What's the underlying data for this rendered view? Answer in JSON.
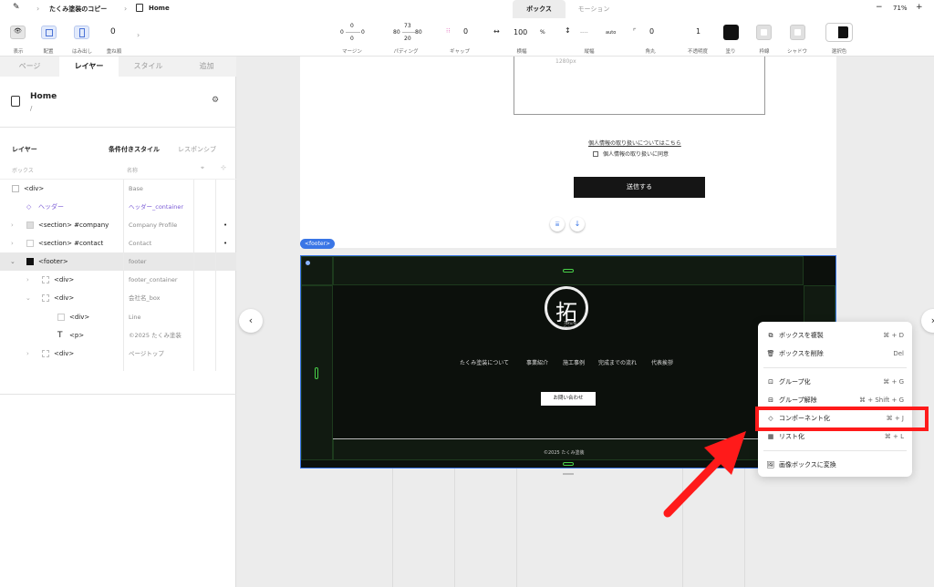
{
  "topbar": {
    "breadcrumb_project": "たくみ塗装のコピー",
    "breadcrumb_page": "Home",
    "tabs": [
      "ボックス",
      "モーション"
    ],
    "zoom": "71%",
    "minus": "−",
    "plus": "+"
  },
  "toolbar": {
    "display": "表示",
    "placement": "配置",
    "overflow": "はみ出し",
    "stack_value": "0",
    "stack_label": "重ね順",
    "margin": {
      "top": "0",
      "left": "0",
      "right": "0",
      "bottom": "0",
      "label": "マージン"
    },
    "padding": {
      "top": "73",
      "left": "80",
      "right": "80",
      "bottom": "20",
      "label": "パディング"
    },
    "gap": {
      "value": "0",
      "label": "ギャップ"
    },
    "width": {
      "value": "100",
      "unit": "%",
      "label": "横幅"
    },
    "height": {
      "value": "----",
      "unit": "auto",
      "label": "縦幅"
    },
    "radius": {
      "value": "0",
      "label": "角丸"
    },
    "opacity": {
      "value": "1",
      "label": "不透明度"
    },
    "fill": "塗り",
    "border": "枠線",
    "shadow": "シャドウ",
    "selection_color": "選択色",
    "colors": {
      "fill": "#111111",
      "accent": "#3a76e6",
      "highlight": "#ff1a1a"
    }
  },
  "panel": {
    "tabs": [
      "ページ",
      "レイヤー",
      "スタイル",
      "追加"
    ],
    "page_title": "Home",
    "page_path": "/",
    "layer_heading": "レイヤー",
    "conditional_style": "条件付きスタイル",
    "responsive": "レスポンシブ",
    "col_box": "ボックス",
    "col_name": "名称",
    "layers": [
      {
        "label": "<div>",
        "name": "Base"
      },
      {
        "label": "ヘッダー",
        "name": "ヘッダー_container"
      },
      {
        "label": "<section> #company",
        "name": "Company Profile",
        "dot": "•"
      },
      {
        "label": "<section> #contact",
        "name": "Contact",
        "dot": "•"
      },
      {
        "label": "<footer>",
        "name": "footer"
      },
      {
        "label": "<div>",
        "name": "footer_container"
      },
      {
        "label": "<div>",
        "name": "会社名_box"
      },
      {
        "label": "<div>",
        "name": "Line"
      },
      {
        "label": "<p>",
        "name": "©2025 たくみ塗装"
      },
      {
        "label": "<div>",
        "name": "ページトップ"
      }
    ]
  },
  "canvas": {
    "width_hint": "1280px",
    "privacy_link": "個人情報の取り扱いについてはこちら",
    "privacy_checkbox": "個人情報の取り扱いに同意",
    "submit": "送信する",
    "footer_tag": "<footer>",
    "logo_char": "拓",
    "logo_sub": "Takumi Paint",
    "nav": [
      "たくみ塗装について",
      "事業紹介",
      "施工事例",
      "完成までの流れ",
      "代表挨拶"
    ],
    "contact_button": "お問い合わせ",
    "copyright": "©2025 たくみ塗装"
  },
  "context_menu": [
    {
      "icon": "copy-icon",
      "label": "ボックスを複製",
      "shortcut": "⌘ + D"
    },
    {
      "icon": "trash-icon",
      "label": "ボックスを削除",
      "shortcut": "Del"
    },
    {
      "icon": "group-icon",
      "label": "グループ化",
      "shortcut": "⌘ + G"
    },
    {
      "icon": "ungroup-icon",
      "label": "グループ解除",
      "shortcut": "⌘ + Shift + G"
    },
    {
      "icon": "component-icon",
      "label": "コンポーネント化",
      "shortcut": "⌘ + J"
    },
    {
      "icon": "list-icon",
      "label": "リスト化",
      "shortcut": "⌘ + L"
    },
    {
      "icon": "image-icon",
      "label": "画像ボックスに変換",
      "shortcut": ""
    }
  ]
}
